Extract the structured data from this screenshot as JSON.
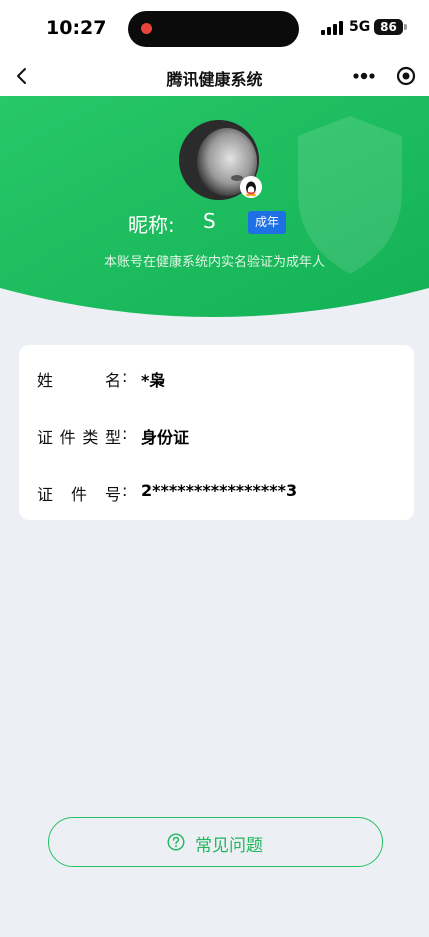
{
  "status_bar": {
    "time": "10:27",
    "network": "5G",
    "battery": "86"
  },
  "nav": {
    "title": "腾讯健康系统"
  },
  "profile": {
    "nickname_label": "昵称:",
    "nickname_value": "S",
    "badge": "成年",
    "note": "本账号在健康系统内实名验证为成年人"
  },
  "info": {
    "rows": [
      {
        "label": "姓名",
        "value": "*枭"
      },
      {
        "label": "证件类型",
        "value": "身份证"
      },
      {
        "label": "证件号",
        "value": "2****************3"
      }
    ],
    "colon": ":"
  },
  "faq": {
    "label": "常见问题"
  },
  "colors": {
    "brand_green": "#1fbf5f",
    "badge_blue": "#1f6fe5",
    "background": "#eceff3"
  },
  "icons": [
    "back-arrow-icon",
    "more-dots-icon",
    "record-circle-icon",
    "qq-penguin-icon",
    "question-circle-icon",
    "shield-watermark-icon"
  ]
}
